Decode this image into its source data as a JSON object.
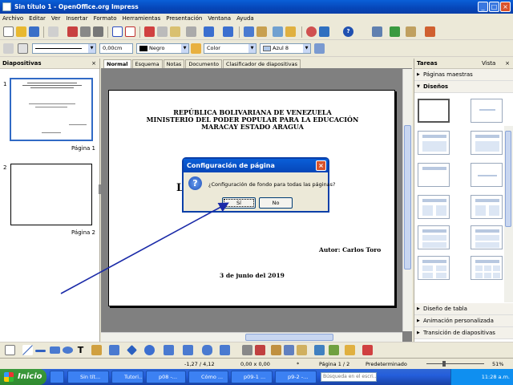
{
  "window": {
    "title": "Sin título 1 - OpenOffice.org Impress"
  },
  "menu": [
    "Archivo",
    "Editar",
    "Ver",
    "Insertar",
    "Formato",
    "Herramientas",
    "Presentación",
    "Ventana",
    "Ayuda"
  ],
  "line_toolbar": {
    "width": "0,00cm",
    "line_color": "Negro",
    "area_style": "Color",
    "area_color": "Azul 8"
  },
  "slides_pane": {
    "title": "Diapositivas",
    "slides": [
      {
        "number": "1",
        "label": "Página 1"
      },
      {
        "number": "2",
        "label": "Página 2"
      }
    ]
  },
  "view_tabs": [
    "Normal",
    "Esquema",
    "Notas",
    "Documento",
    "Clasificador de diapositivas"
  ],
  "slide": {
    "line1": "REPÚBLICA BOLIVARIANA DE VENEZUELA",
    "line2": "MINISTERIO DEL PODER POPULAR PARA LA EDUCACIÓN",
    "line3": "MARACAY ESTADO ARAGUA",
    "partial": "L",
    "author": "Autor: Carlos Toro",
    "date": "3 de junio del 2019"
  },
  "dialog": {
    "title": "Configuración de página",
    "message": "¿Configuración de fondo para todas las páginas?",
    "yes": "Sí",
    "no": "No"
  },
  "tasks_pane": {
    "title": "Tareas",
    "view": "Vista",
    "sections": {
      "master": "Páginas maestras",
      "layouts": "Diseños",
      "table": "Diseño de tabla",
      "animation": "Animación personalizada",
      "transition": "Transición de diapositivas"
    }
  },
  "status": {
    "position": "-1,27 / 4,12",
    "size": "0,00 x 0,00",
    "asterisk": "*",
    "page": "Página 1 / 2",
    "master": "Predeterminado",
    "zoom": "51%"
  },
  "taskbar": {
    "start": "Inicio",
    "items": [
      "Sin tít...",
      "Tutori...",
      "p08 -...",
      "Cómo ...",
      "p09-1 ...",
      "p9-2 -..."
    ],
    "search": "Búsqueda en el escri...",
    "clock": "11:28 a.m."
  },
  "colors": {
    "arrow": "#1a2aa8",
    "accent": "#0a5fd8"
  }
}
